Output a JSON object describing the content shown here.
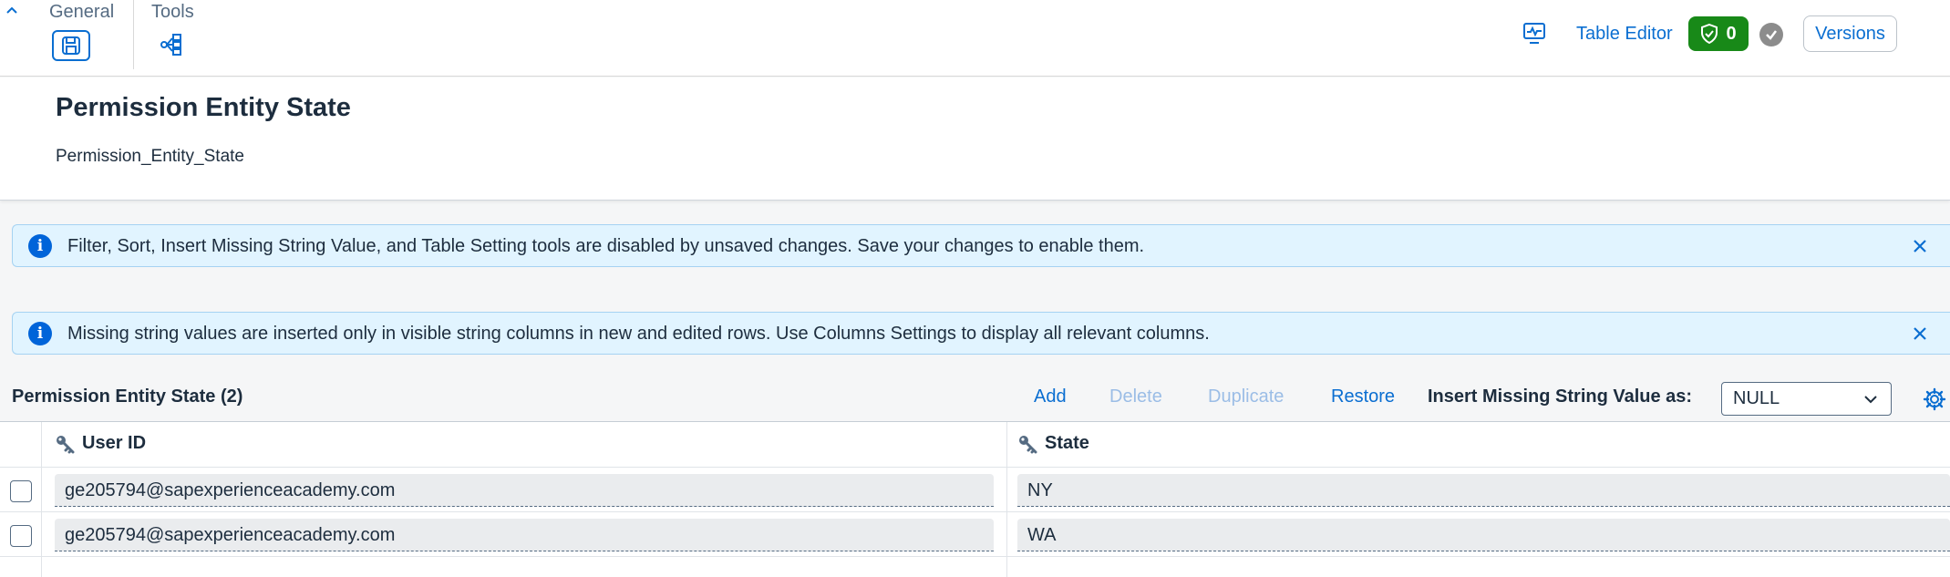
{
  "toolbar": {
    "groups": [
      {
        "label": "General"
      },
      {
        "label": "Tools"
      }
    ],
    "table_editor_label": "Table Editor",
    "validation_count": "0",
    "versions_label": "Versions"
  },
  "header": {
    "title": "Permission Entity State",
    "subtitle": "Permission_Entity_State"
  },
  "messages": [
    {
      "text": "Filter, Sort, Insert Missing String Value, and Table Setting tools are disabled by unsaved changes. Save your changes to enable them."
    },
    {
      "text": "Missing string values are inserted only in visible string columns in new and edited rows. Use Columns Settings to display all relevant columns."
    }
  ],
  "table_toolbar": {
    "title": "Permission Entity State (2)",
    "add_label": "Add",
    "delete_label": "Delete",
    "duplicate_label": "Duplicate",
    "restore_label": "Restore",
    "insert_missing_label": "Insert Missing String Value as:",
    "insert_missing_value": "NULL"
  },
  "table": {
    "columns": [
      {
        "label": "User ID"
      },
      {
        "label": "State"
      }
    ],
    "rows": [
      {
        "user_id": "ge205794@sapexperienceacademy.com",
        "state": "NY"
      },
      {
        "user_id": "ge205794@sapexperienceacademy.com",
        "state": "WA"
      }
    ]
  },
  "colors": {
    "accent": "#0a6ed1",
    "success": "#188918",
    "info_bg": "#e1f4ff",
    "info_icon": "#0064d9",
    "disabled_text": "#9bbde6"
  },
  "icons": [
    "chevron-up-icon",
    "save-icon",
    "hierarchy-icon",
    "monitor-icon",
    "shield-check-icon",
    "checkmark-icon",
    "information-icon",
    "close-icon",
    "chevron-down-icon",
    "settings-gear-icon",
    "key-icon"
  ]
}
